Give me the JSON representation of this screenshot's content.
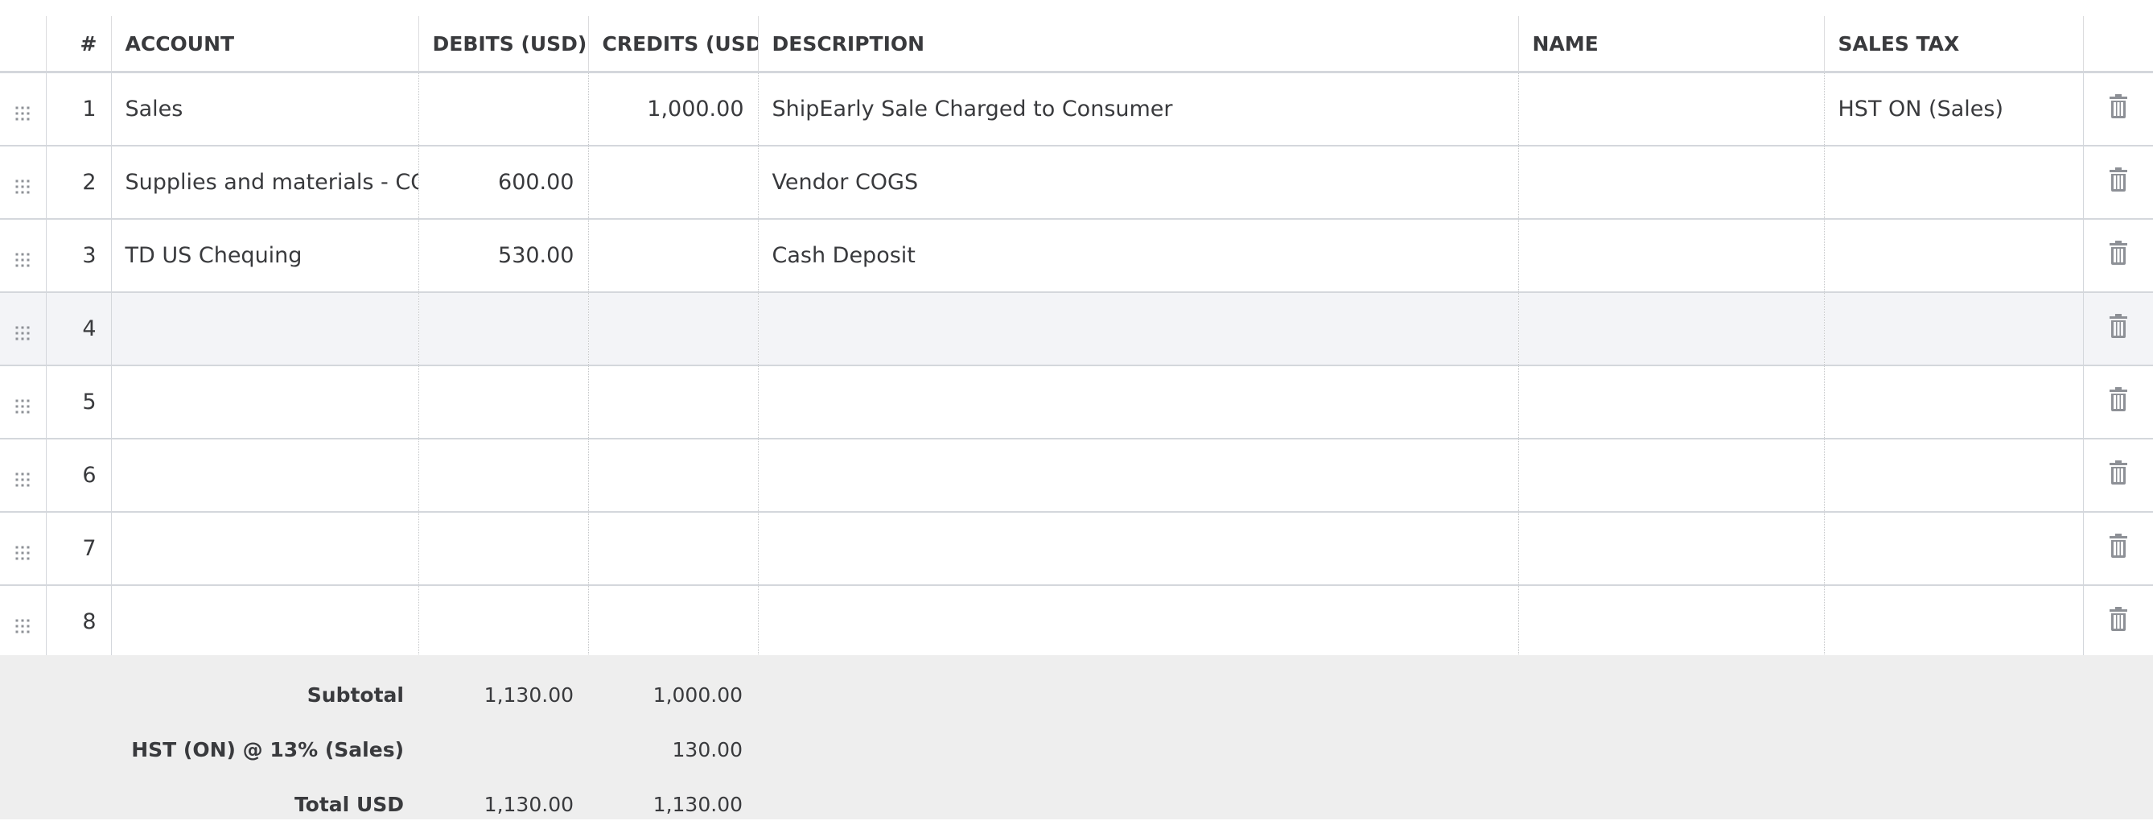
{
  "header": {
    "number": "#",
    "account": "ACCOUNT",
    "debits": "DEBITS (USD)",
    "credits": "CREDITS (USD)",
    "description": "DESCRIPTION",
    "name": "NAME",
    "sales_tax": "SALES TAX"
  },
  "rows": [
    {
      "num": "1",
      "account": "Sales",
      "debits": "",
      "credits": "1,000.00",
      "description": "ShipEarly Sale Charged to Consumer",
      "name": "",
      "sales_tax": "HST ON (Sales)"
    },
    {
      "num": "2",
      "account": "Supplies and materials - COS",
      "debits": "600.00",
      "credits": "",
      "description": "Vendor COGS",
      "name": "",
      "sales_tax": ""
    },
    {
      "num": "3",
      "account": "TD US Chequing",
      "debits": "530.00",
      "credits": "",
      "description": "Cash Deposit",
      "name": "",
      "sales_tax": ""
    },
    {
      "num": "4",
      "account": "",
      "debits": "",
      "credits": "",
      "description": "",
      "name": "",
      "sales_tax": ""
    },
    {
      "num": "5",
      "account": "",
      "debits": "",
      "credits": "",
      "description": "",
      "name": "",
      "sales_tax": ""
    },
    {
      "num": "6",
      "account": "",
      "debits": "",
      "credits": "",
      "description": "",
      "name": "",
      "sales_tax": ""
    },
    {
      "num": "7",
      "account": "",
      "debits": "",
      "credits": "",
      "description": "",
      "name": "",
      "sales_tax": ""
    },
    {
      "num": "8",
      "account": "",
      "debits": "",
      "credits": "",
      "description": "",
      "name": "",
      "sales_tax": ""
    }
  ],
  "totals": {
    "subtotal": {
      "label": "Subtotal",
      "debits": "1,130.00",
      "credits": "1,000.00"
    },
    "tax": {
      "label": "HST (ON) @ 13% (Sales)",
      "debits": "",
      "credits": "130.00"
    },
    "total": {
      "label": "Total USD",
      "debits": "1,130.00",
      "credits": "1,130.00"
    }
  },
  "icons": {
    "drag": "drag-handle-icon",
    "trash": "trash-icon"
  },
  "colors": {
    "text": "#393a3d",
    "icon": "#8d9096",
    "active_row": "#f3f4f7",
    "totals_bg": "#eeeeee",
    "border": "#d4d7dc"
  }
}
